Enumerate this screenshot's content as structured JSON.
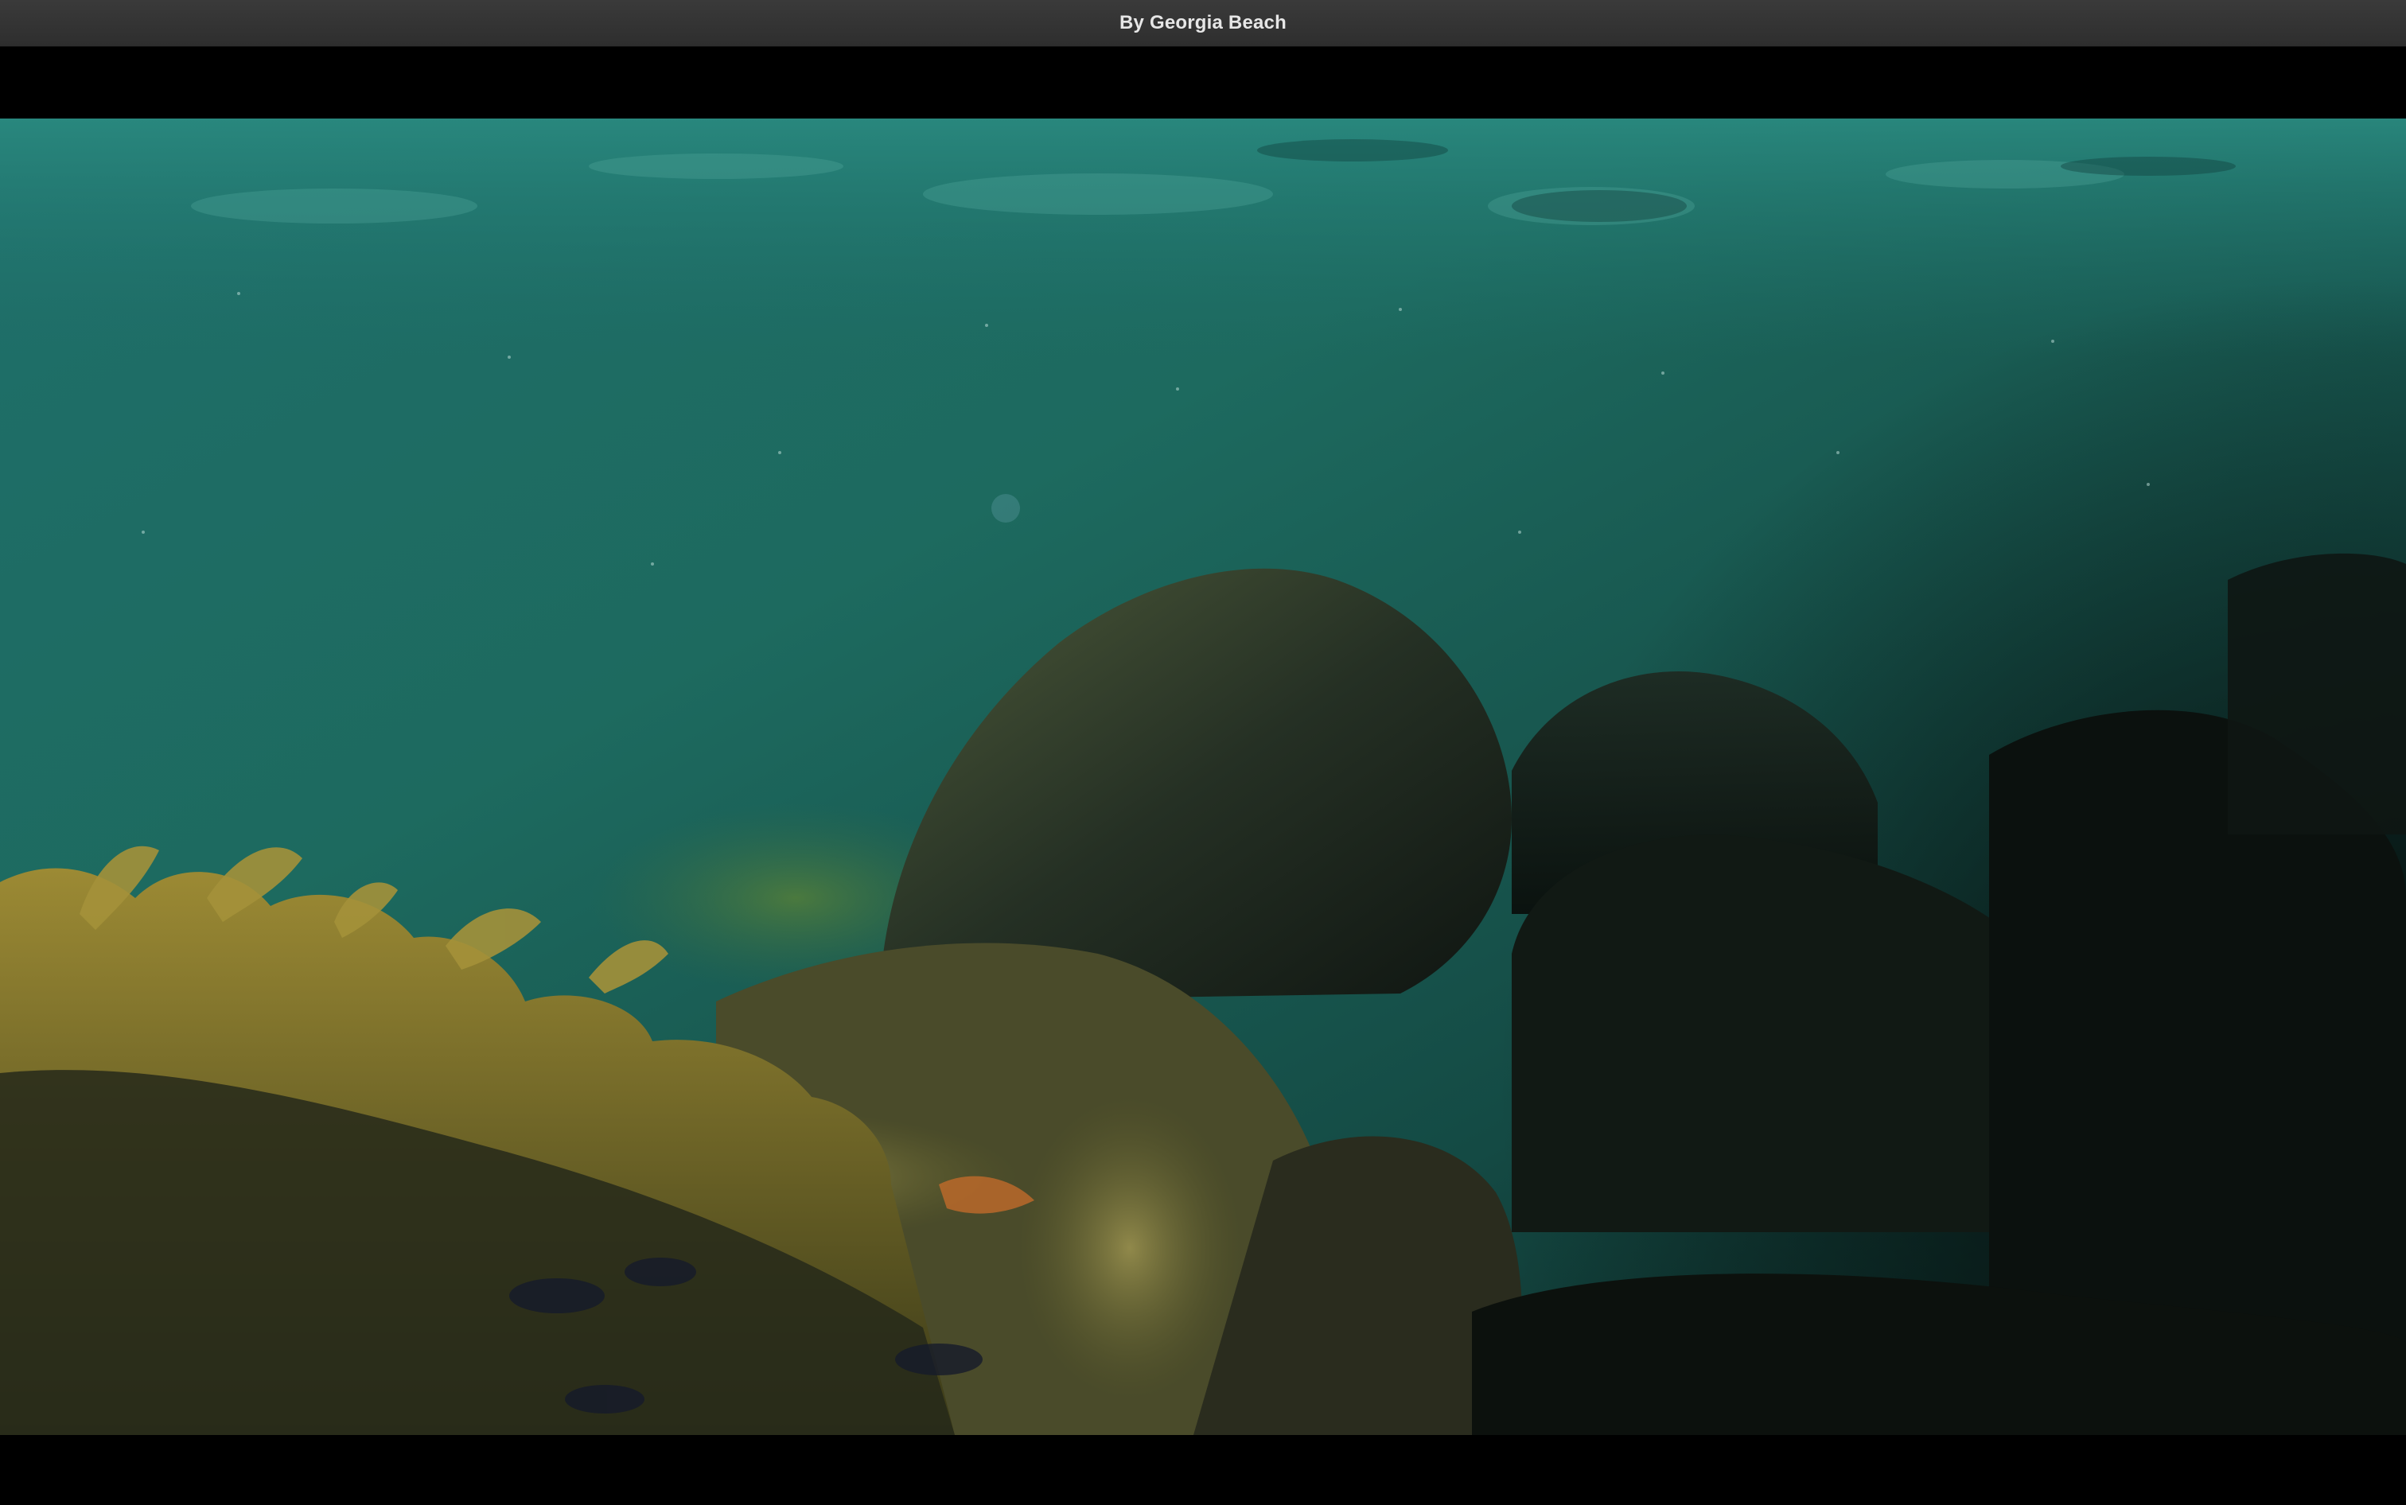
{
  "window": {
    "title": "By Georgia Beach"
  },
  "video": {
    "scene": "underwater-reef",
    "colors": {
      "water_top": "#1f6f6a",
      "water_mid": "#1b5f55",
      "water_deep": "#0d2624",
      "seaweed": "#8a7a2a",
      "rock_dark": "#121a14",
      "sand_light": "#b3a55a"
    }
  }
}
